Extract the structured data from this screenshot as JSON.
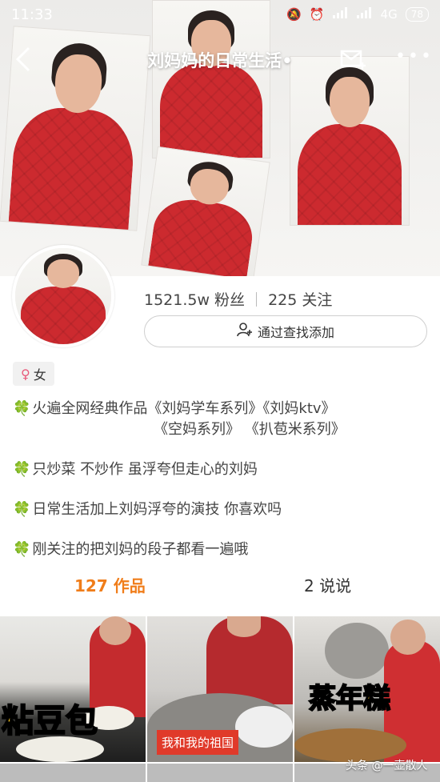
{
  "status_bar": {
    "time": "11:33",
    "network": "4G",
    "battery": "78"
  },
  "nav": {
    "title": "刘妈妈的日常生活•"
  },
  "profile": {
    "fans": "1521.5w 粉丝",
    "following": "225 关注",
    "add_button": "通过查找添加",
    "gender": "女"
  },
  "bio": {
    "line1a": "火遍全网经典作品《刘妈学车系列》《刘妈ktv》",
    "line1b": "《空妈系列》 《扒苞米系列》",
    "line2": "只炒菜 不炒作 虽浮夸但走心的刘妈",
    "line3": "日常生活加上刘妈浮夸的演技 你喜欢吗",
    "line4": "刚关注的把刘妈的段子都看一遍哦"
  },
  "tabs": {
    "works": "127 作品",
    "posts": "2 说说"
  },
  "videos": [
    {
      "caption": "粘豆包"
    },
    {
      "tag": "我和我的祖国"
    },
    {
      "caption": "蒸年糕"
    }
  ],
  "watermark": "头条 @一壶散人",
  "colors": {
    "accent": "#f07d1a",
    "jacket": "#cc2a2f",
    "clover": "#4aa02c"
  }
}
